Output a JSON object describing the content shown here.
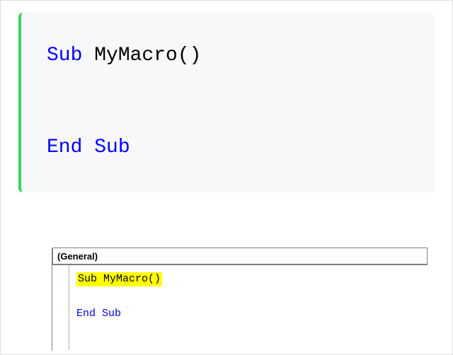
{
  "snippet": {
    "line1_kw": "Sub",
    "line1_ident": " MyMacro()",
    "line2_kw": "End Sub"
  },
  "editor": {
    "dropdown_label": "(General)",
    "line1_full": "Sub MyMacro()",
    "line2_kw": "End Sub"
  }
}
